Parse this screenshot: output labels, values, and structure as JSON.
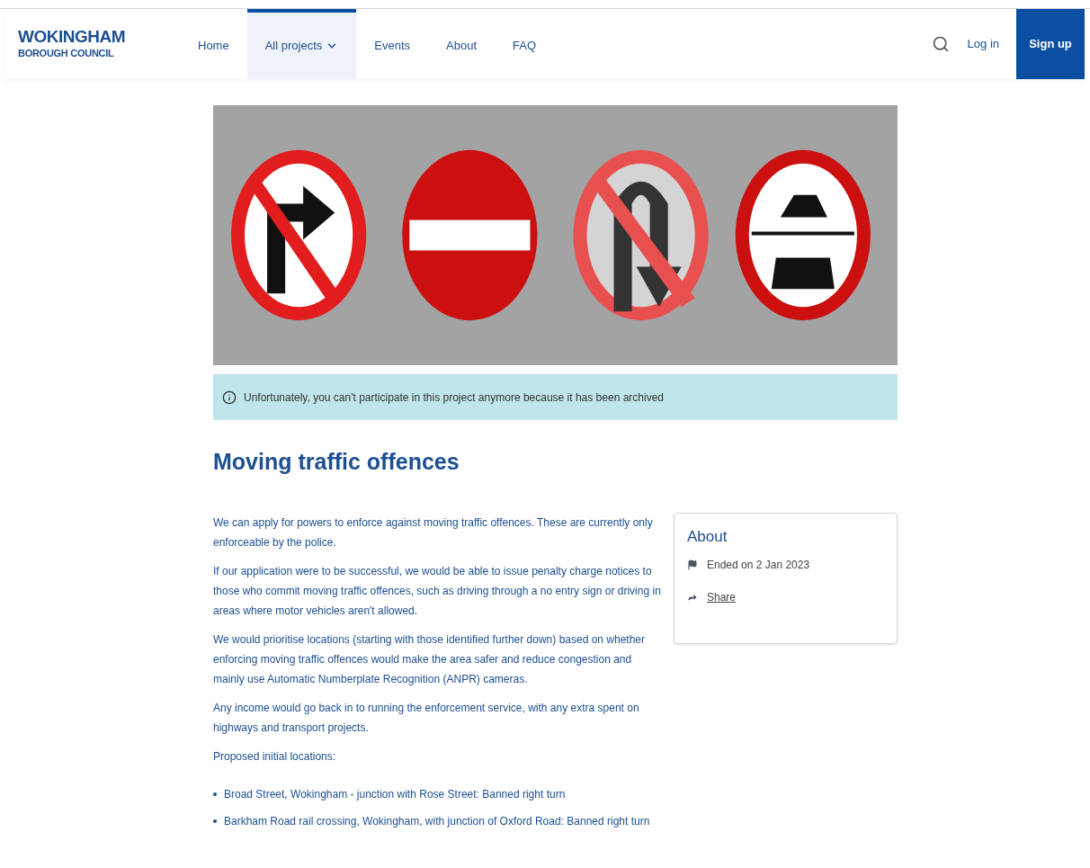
{
  "header": {
    "logo": {
      "line1": "WOKINGHAM",
      "line2": "BOROUGH COUNCIL"
    },
    "nav": [
      {
        "label": "Home",
        "selected": false,
        "dropdown": false
      },
      {
        "label": "All projects",
        "selected": true,
        "dropdown": true
      },
      {
        "label": "Events",
        "selected": false,
        "dropdown": false
      },
      {
        "label": "About",
        "selected": false,
        "dropdown": false
      },
      {
        "label": "FAQ",
        "selected": false,
        "dropdown": false
      }
    ],
    "login": "Log in",
    "signup": "Sign up"
  },
  "notice": "Unfortunately, you can't participate in this project anymore because it has been archived",
  "title": "Moving traffic offences",
  "paragraphs": [
    "We can apply for powers to enforce against moving traffic offences. These are currently only enforceable by the police.",
    "If our application were to be successful, we would be able to issue penalty charge notices to those who commit moving traffic offences, such as driving through a no entry sign or driving in areas where motor vehicles aren't allowed.",
    "We would prioritise locations (starting with those identified further down) based on whether enforcing moving traffic offences would make the area safer and reduce congestion and mainly use Automatic Numberplate Recognition (ANPR) cameras.",
    "Any income would go back in to running the enforcement service, with any extra spent on highways and transport projects.",
    "Proposed initial locations:"
  ],
  "locations": [
    "Broad Street, Wokingham - junction with Rose Street: Banned right turn",
    "Barkham Road rail crossing, Wokingham, with junction of Oxford Road: Banned right turn"
  ],
  "about": {
    "title": "About",
    "ended": "Ended on 2 Jan 2023",
    "share": "Share"
  }
}
